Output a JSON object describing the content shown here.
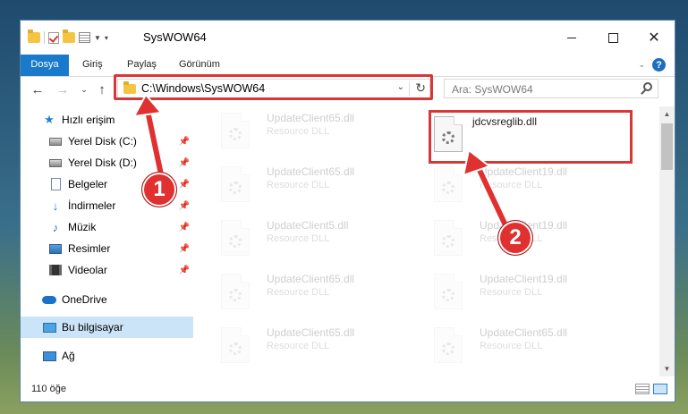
{
  "window": {
    "title": "SysWOW64"
  },
  "ribbon": {
    "tabs": [
      "Dosya",
      "Giriş",
      "Paylaş",
      "Görünüm"
    ]
  },
  "address": {
    "path": "C:\\Windows\\SysWOW64"
  },
  "search": {
    "placeholder": "Ara: SysWOW64"
  },
  "nav": {
    "quick_access": "Hızlı erişim",
    "items": [
      "Yerel Disk (C:)",
      "Yerel Disk (D:)",
      "Belgeler",
      "İndirmeler",
      "Müzik",
      "Resimler",
      "Videolar"
    ],
    "onedrive": "OneDrive",
    "this_pc": "Bu bilgisayar",
    "network": "Ağ"
  },
  "files": {
    "left_column": [
      {
        "name": "UpdateClient65.dll",
        "type": "Resource DLL"
      },
      {
        "name": "UpdateClient65.dll",
        "type": "Resource DLL"
      },
      {
        "name": "UpdateClient5.dll",
        "type": "Resource DLL"
      },
      {
        "name": "UpdateClient65.dll",
        "type": "Resource DLL"
      },
      {
        "name": "UpdateClient65.dll",
        "type": "Resource DLL"
      }
    ],
    "right_column": [
      {
        "name": "jdcvsreglib.dll",
        "type": ""
      },
      {
        "name": "UpdateClient19.dll",
        "type": "Resource DLL"
      },
      {
        "name": "UpdateClient19.dll",
        "type": "Resource DLL"
      },
      {
        "name": "UpdateClient19.dll",
        "type": "Resource DLL"
      },
      {
        "name": "UpdateClient65.dll",
        "type": "Resource DLL"
      }
    ]
  },
  "status": {
    "item_count": "110 öğe"
  },
  "callouts": {
    "one": "1",
    "two": "2"
  },
  "colors": {
    "accent": "#1979ca",
    "highlight": "#d93636",
    "selected": "#cce4f7"
  }
}
